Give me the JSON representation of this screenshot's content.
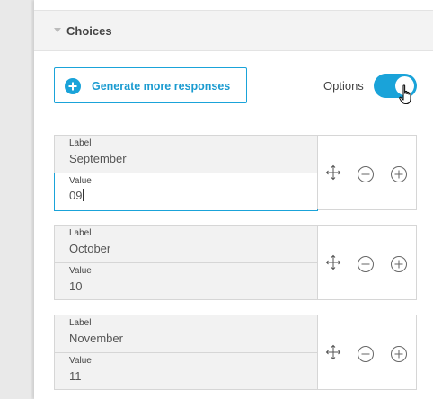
{
  "section": {
    "title": "Choices"
  },
  "toolbar": {
    "generate_label": "Generate more responses",
    "options_label": "Options",
    "options_enabled": true
  },
  "captions": {
    "label": "Label",
    "value": "Value"
  },
  "choices": [
    {
      "label": "September",
      "value": "09"
    },
    {
      "label": "October",
      "value": "10"
    },
    {
      "label": "November",
      "value": "11"
    }
  ],
  "colors": {
    "accent": "#1aa3d9",
    "panel": "#f2f2f2",
    "border": "#d6d6d6"
  }
}
